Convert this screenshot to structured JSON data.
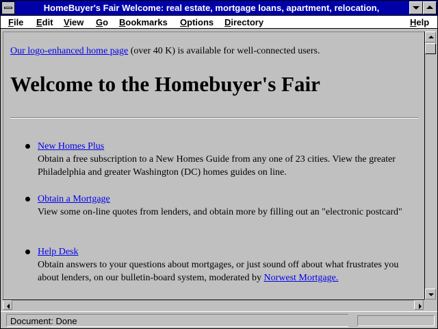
{
  "window": {
    "title": "HomeBuyer's Fair Welcome: real estate, mortgage loans, apartment, relocation,"
  },
  "menubar": {
    "items": [
      {
        "label": "File"
      },
      {
        "label": "Edit"
      },
      {
        "label": "View"
      },
      {
        "label": "Go"
      },
      {
        "label": "Bookmarks"
      },
      {
        "label": "Options"
      },
      {
        "label": "Directory"
      }
    ],
    "help": "Help"
  },
  "content": {
    "intro": {
      "link": "Our logo-enhanced home page",
      "text": " (over 40 K) is available for well-connected users."
    },
    "title": "Welcome to the Homebuyer's Fair",
    "entries": [
      {
        "link": "New Homes Plus",
        "description": "Obtain a free subscription to a New Homes Guide from any one of 23 cities. View the greater Philadelphia and greater Washington (DC) homes guides on line."
      },
      {
        "link": "Obtain a Mortgage",
        "description": "View some on-line quotes from lenders, and obtain more by filling out an \"electronic postcard\""
      },
      {
        "link": "Help Desk",
        "description": "Obtain answers to your questions about mortgages, or just sound off about what frustrates you about lenders, on our bulletin-board system, moderated by ",
        "trailing_link": "Norwest Mortgage."
      }
    ]
  },
  "statusbar": {
    "text": "Document: Done"
  },
  "icons": {
    "system_menu": "system-menu-icon",
    "minimize": "minimize-icon",
    "maximize": "maximize-icon",
    "scroll_up": "scroll-up-arrow-icon",
    "scroll_down": "scroll-down-arrow-icon",
    "scroll_left": "scroll-left-arrow-icon",
    "scroll_right": "scroll-right-arrow-icon"
  },
  "colors": {
    "title_bar": "#0000a8",
    "link": "#0000ee",
    "chrome": "#c0c0c0"
  }
}
